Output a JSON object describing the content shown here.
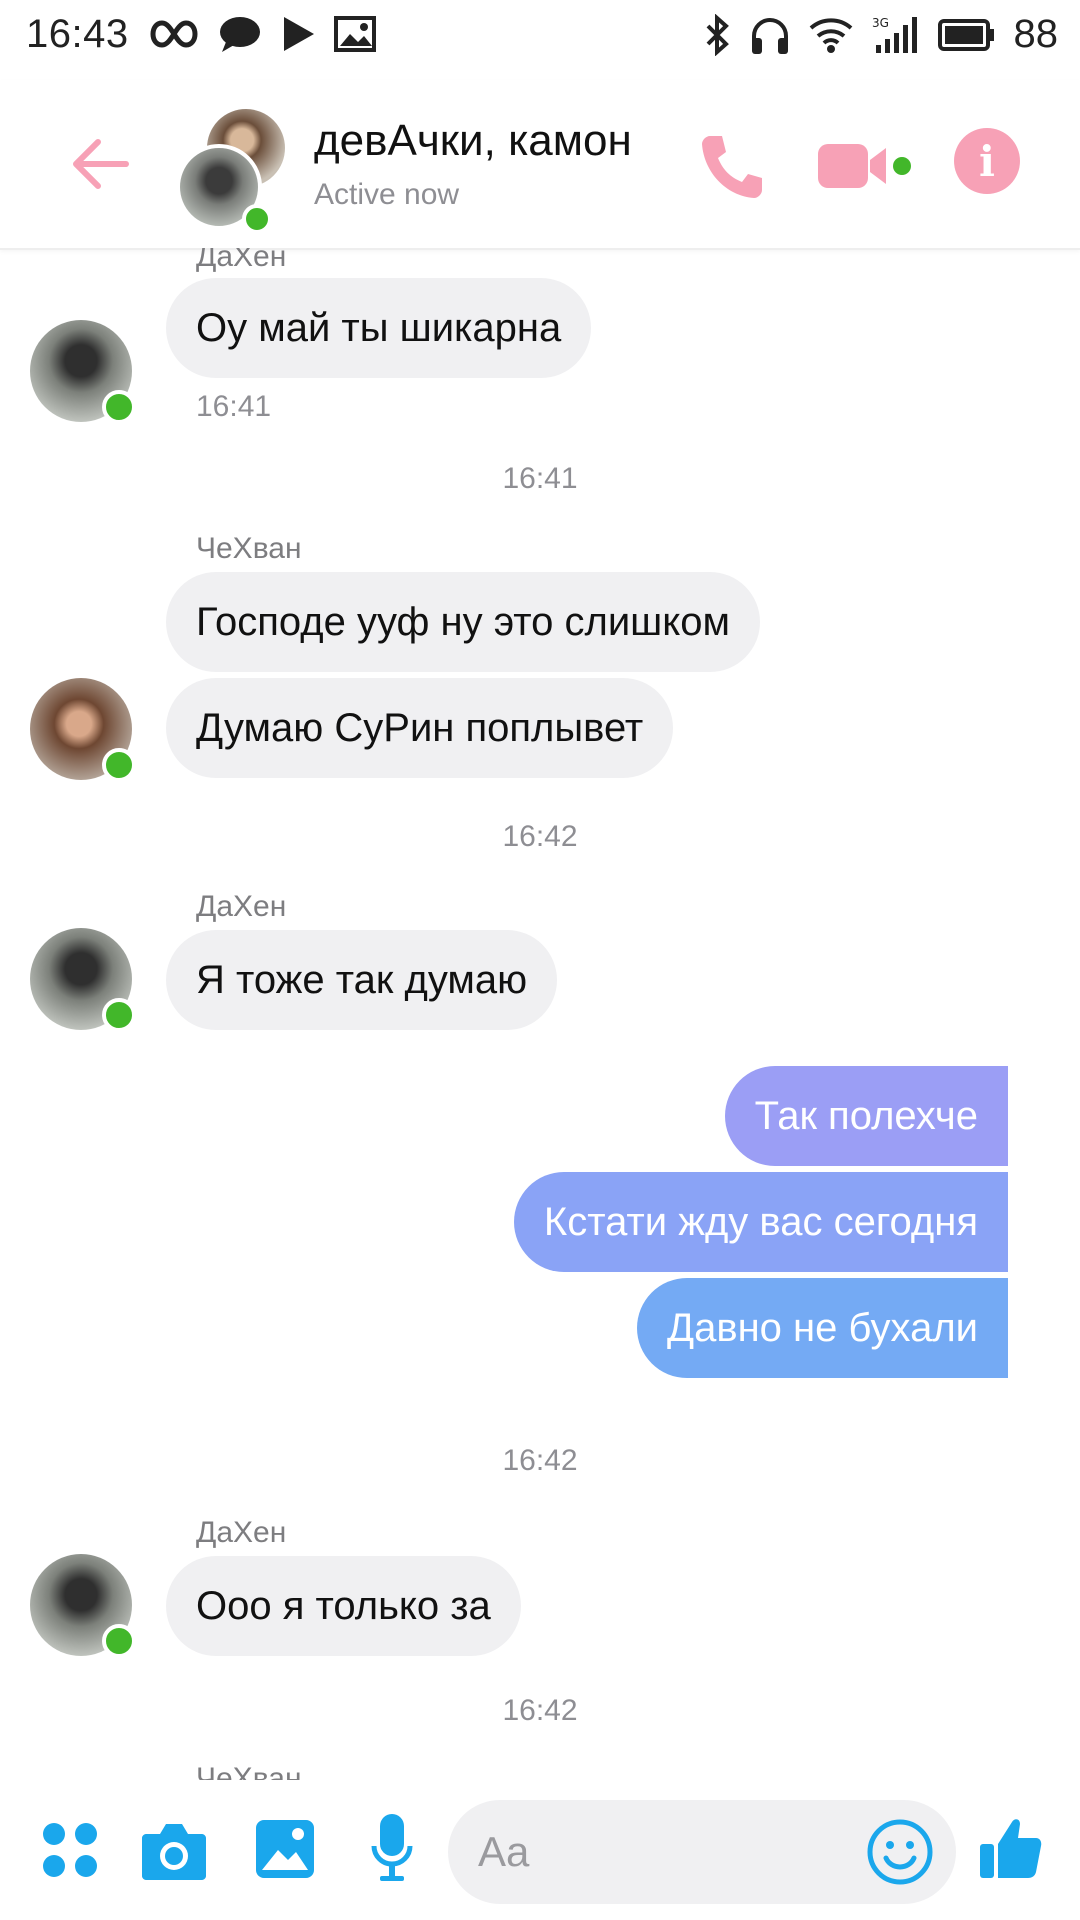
{
  "status_bar": {
    "time": "16:43",
    "network_label": "3G",
    "battery": "88"
  },
  "header": {
    "title": "девАчки, камон",
    "status": "Active now"
  },
  "messages": {
    "m1": {
      "sender": "ДаХен",
      "text": "Оу май ты шикарна",
      "time": "16:41"
    },
    "sep1": "16:41",
    "m2": {
      "sender": "ЧеХван",
      "lines": [
        "Господе ууф ну это слишком",
        "Думаю СуРин поплывет"
      ]
    },
    "sep2": "16:42",
    "m3": {
      "sender": "ДаХен",
      "text": "Я тоже так думаю"
    },
    "outgoing": [
      "Так полехче",
      "Кстати жду вас сегодня",
      "Давно не бухали"
    ],
    "sep3": "16:42",
    "m4": {
      "sender": "ДаХен",
      "text": "Ооо я только за"
    },
    "sep4": "16:42",
    "m5": {
      "sender": "ЧеХван"
    }
  },
  "composer": {
    "placeholder": "Aa"
  },
  "colors": {
    "accent_pink": "#f7a1b6",
    "accent_blue": "#1aa7ec",
    "online_green": "#42b72a",
    "bubble_in": "#f0f0f2"
  },
  "icons": [
    "infinity-icon",
    "chat-bubble-icon",
    "play-icon",
    "image-icon",
    "bluetooth-icon",
    "headphones-icon",
    "wifi-icon",
    "signal-icon",
    "battery-icon",
    "back-arrow-icon",
    "phone-icon",
    "video-camera-icon",
    "info-icon",
    "apps-grid-icon",
    "camera-icon",
    "gallery-icon",
    "microphone-icon",
    "emoji-icon",
    "thumbs-up-icon"
  ]
}
